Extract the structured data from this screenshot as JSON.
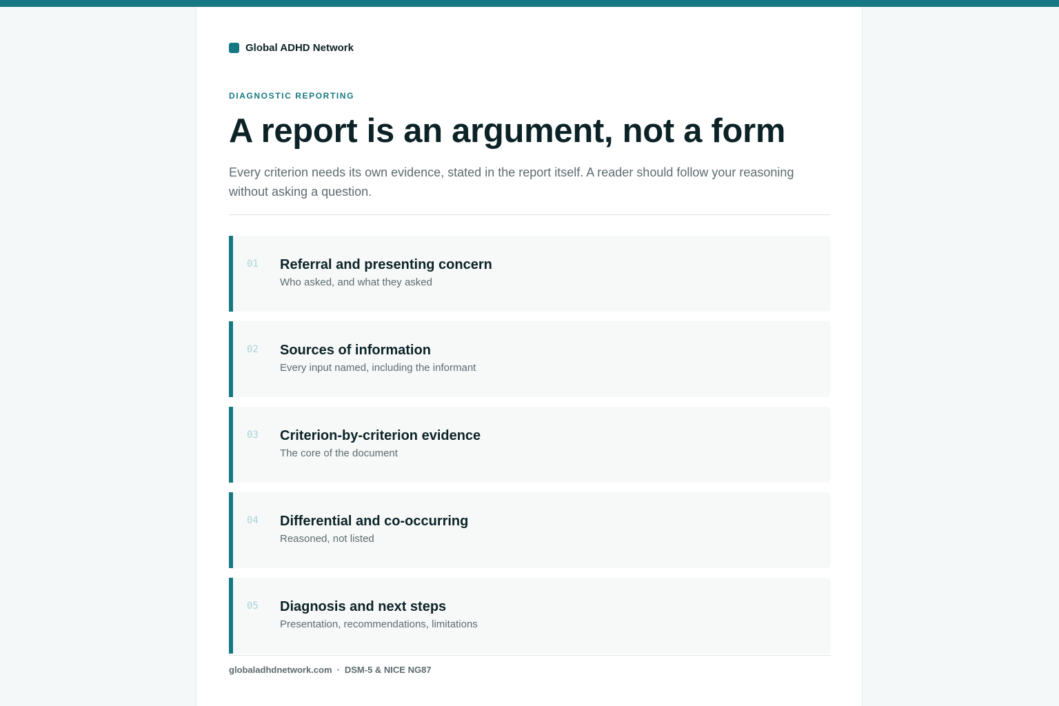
{
  "brand": {
    "name": "Global ADHD Network"
  },
  "hero": {
    "eyebrow": "DIAGNOSTIC REPORTING",
    "title": "A report is an argument, not a form",
    "subtitle": "Every criterion needs its own evidence, stated in the report itself. A reader should follow your reasoning without asking a question."
  },
  "sections": [
    {
      "num": "01",
      "title": "Referral and presenting concern",
      "desc": "Who asked, and what they asked"
    },
    {
      "num": "02",
      "title": "Sources of information",
      "desc": "Every input named, including the informant"
    },
    {
      "num": "03",
      "title": "Criterion-by-criterion evidence",
      "desc": "The core of the document"
    },
    {
      "num": "04",
      "title": "Differential and co-occurring",
      "desc": "Reasoned, not listed"
    },
    {
      "num": "05",
      "title": "Diagnosis and next steps",
      "desc": "Presentation, recommendations, limitations"
    }
  ],
  "footer": {
    "site": "globaladhdnetwork.com",
    "separator": "·",
    "standards": "DSM-5 & NICE NG87"
  },
  "colors": {
    "accent": "#167883",
    "text_dark": "#0c2226",
    "text_muted": "#5d6b6e",
    "number_light": "#a9d3d6"
  }
}
